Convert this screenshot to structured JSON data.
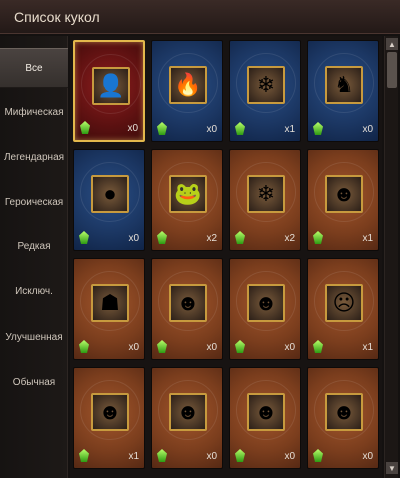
{
  "window": {
    "title": "Список кукол"
  },
  "sidebar": {
    "items": [
      {
        "label": "Все",
        "active": true
      },
      {
        "label": "Мифическая"
      },
      {
        "label": "Легендарная"
      },
      {
        "label": "Героическая"
      },
      {
        "label": "Редкая"
      },
      {
        "label": "Исключ."
      },
      {
        "label": "Улучшенная"
      },
      {
        "label": "Обычная"
      }
    ]
  },
  "cards": [
    {
      "count": "x0",
      "frame": "red",
      "selected": true,
      "icon": "white-haired-doll-icon",
      "glyph": "👤"
    },
    {
      "count": "x0",
      "frame": "blue",
      "icon": "fire-spirit-doll-icon",
      "glyph": "🔥"
    },
    {
      "count": "x1",
      "frame": "blue",
      "icon": "ice-demon-doll-icon",
      "glyph": "❄"
    },
    {
      "count": "x0",
      "frame": "blue",
      "icon": "dark-knight-doll-icon",
      "glyph": "♞"
    },
    {
      "count": "x0",
      "frame": "blue",
      "icon": "crystal-orb-doll-icon",
      "glyph": "●"
    },
    {
      "count": "x2",
      "frame": "orange",
      "icon": "frog-doll-icon",
      "glyph": "🐸"
    },
    {
      "count": "x2",
      "frame": "orange",
      "icon": "ice-golem-doll-icon",
      "glyph": "❄"
    },
    {
      "count": "x1",
      "frame": "orange",
      "icon": "aqua-imp-doll-icon",
      "glyph": "☻"
    },
    {
      "count": "x0",
      "frame": "orange",
      "icon": "stone-golem-doll-icon",
      "glyph": "☗"
    },
    {
      "count": "x0",
      "frame": "orange",
      "icon": "red-devil-doll-icon",
      "glyph": "☻"
    },
    {
      "count": "x0",
      "frame": "orange",
      "icon": "beast-doll-icon",
      "glyph": "☻"
    },
    {
      "count": "x1",
      "frame": "orange",
      "icon": "masked-doll-icon",
      "glyph": "☹"
    },
    {
      "count": "x1",
      "frame": "orange",
      "icon": "wizard-doll-icon",
      "glyph": "☻"
    },
    {
      "count": "x0",
      "frame": "orange",
      "icon": "red-imp-doll-icon",
      "glyph": "☻"
    },
    {
      "count": "x0",
      "frame": "orange",
      "icon": "monk-doll-icon",
      "glyph": "☻"
    },
    {
      "count": "x0",
      "frame": "orange",
      "icon": "hooded-warrior-doll-icon",
      "glyph": "☻"
    }
  ],
  "colors": {
    "selected_border": "#e3b84c",
    "gem": "#5fd12a"
  }
}
